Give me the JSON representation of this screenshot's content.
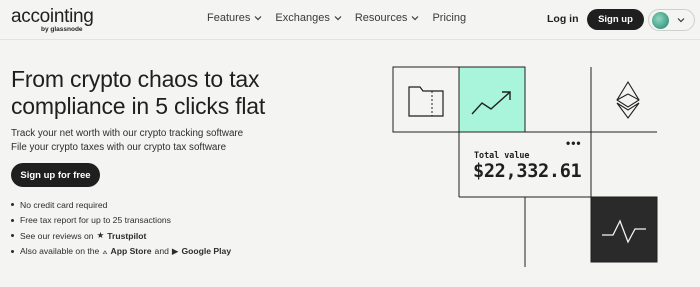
{
  "header": {
    "logo": {
      "main": "accointing",
      "sub": "by glassnode"
    },
    "nav": [
      {
        "label": "Features",
        "dropdown": true
      },
      {
        "label": "Exchanges",
        "dropdown": true
      },
      {
        "label": "Resources",
        "dropdown": true
      },
      {
        "label": "Pricing",
        "dropdown": false
      }
    ],
    "login_label": "Log in",
    "signup_label": "Sign up",
    "language_icon": "globe-icon"
  },
  "hero": {
    "title": "From crypto chaos to tax compliance in 5 clicks flat",
    "subtitle_1": "Track your net worth with our crypto tracking software",
    "subtitle_2": "File your crypto taxes with our crypto tax software",
    "cta_label": "Sign up for free",
    "bullets": {
      "b1": "No credit card required",
      "b2": "Free tax report for up to 25 transactions",
      "b3_prefix": "See our reviews on",
      "b3_brand": "Trustpilot",
      "b4_prefix": "Also available on the",
      "b4_app_store": "App Store",
      "b4_and": "and",
      "b4_google_play": "Google Play"
    }
  },
  "illustration": {
    "total_label": "Total value",
    "total_value": "$22,332.61",
    "accent_color": "#a8f5dc",
    "dark_tile_color": "#2a2a2a",
    "icons": [
      "folder-icon",
      "trend-up-icon",
      "ethereum-icon",
      "pulse-icon",
      "more-dots-icon"
    ]
  }
}
